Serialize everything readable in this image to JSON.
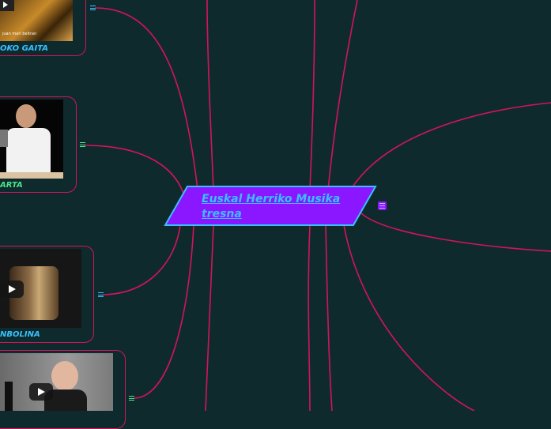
{
  "colors": {
    "background": "#0f2a2d",
    "branch": "#d4145a",
    "central_fill": "#8a17ff",
    "central_border": "#36c2ff",
    "caption_blue": "#36c2ff",
    "caption_green": "#4be38a",
    "menu_icon": "#36c2ff"
  },
  "central_topic": {
    "title": " Euskal Herriko Musika tresna"
  },
  "left_nodes": [
    {
      "caption": "OKO GAITA",
      "thumb_text": "juan mari beltran",
      "media": "image"
    },
    {
      "caption": "ARTA",
      "media": "image"
    },
    {
      "caption": "NBOLINA",
      "media": "video"
    },
    {
      "caption": "",
      "media": "video"
    }
  ],
  "icons": {
    "menu": "hamburger-menu-icon",
    "play": "play-icon"
  }
}
